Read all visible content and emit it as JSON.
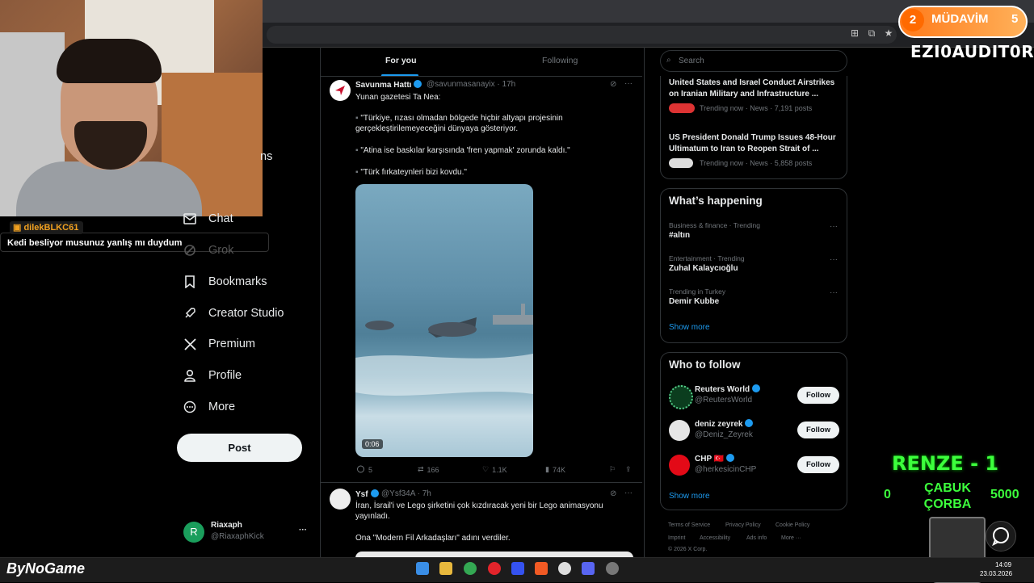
{
  "tabs": {
    "for_you": "For you",
    "following": "Following"
  },
  "nav": {
    "partial": "ns",
    "chat": "Chat",
    "grok": "Grok",
    "bookmarks": "Bookmarks",
    "creator_studio": "Creator Studio",
    "premium": "Premium",
    "profile": "Profile",
    "more": "More",
    "post": "Post"
  },
  "account": {
    "initial": "R",
    "name": "Riaxaph",
    "handle": "@RiaxaphKick",
    "menu": "···"
  },
  "chat_overlay": {
    "user": "dilekBLKC61",
    "message": "Kedi besliyor musunuz yanlış mı duydum"
  },
  "tweets": [
    {
      "name": "Savunma Hattı",
      "handle": "@savunmasanayix · 17h",
      "lines": [
        "Yunan gazetesi Ta Nea:",
        "\"Türkiye, rızası olmadan bölgede hiçbir altyapı projesinin gerçekleştirilemeyeceğini dünyaya gösteriyor.",
        "\"Atina ise baskılar karşısında 'fren yapmak' zorunda kaldı.\"",
        "\"Türk fırkateynleri bizi kovdu.\""
      ],
      "video_time": "0:06",
      "replies": "5",
      "reposts": "166",
      "likes": "1.1K",
      "views": "74K"
    },
    {
      "name": "Ysf",
      "handle": "@Ysf34A · 7h",
      "lines": [
        "İran, İsrail'i ve Lego şirketini çok kızdıracak yeni bir Lego animasyonu yayınladı.",
        "Ona \"Modern Fil Arkadaşları\" adını verdiler."
      ]
    }
  ],
  "search": {
    "placeholder": "Search"
  },
  "news": [
    {
      "title": "United States and Israel Conduct Airstrikes on Iranian Military and Infrastructure ...",
      "meta": "Trending now · News · 7,191 posts"
    },
    {
      "title": "US President Donald Trump Issues 48-Hour Ultimatum to Iran to Reopen Strait of ...",
      "meta": "Trending now · News · 5,858 posts"
    }
  ],
  "whats_happening": {
    "title": "What’s happening",
    "trends": [
      {
        "category": "Business & finance · Trending",
        "name": "#altın"
      },
      {
        "category": "Entertainment · Trending",
        "name": "Zuhal Kalaycıoğlu"
      },
      {
        "category": "Trending in Turkey",
        "name": "Demir Kubbe"
      }
    ],
    "show_more": "Show more",
    "more_icon": "···"
  },
  "who_to_follow": {
    "title": "Who to follow",
    "accounts": [
      {
        "name": "Reuters World",
        "handle": "@ReutersWorld",
        "button": "Follow"
      },
      {
        "name": "deniz zeyrek",
        "handle": "@Deniz_Zeyrek",
        "button": "Follow"
      },
      {
        "name": "CHP 🇹🇷",
        "handle": "@herkesicinCHP",
        "button": "Follow"
      }
    ],
    "show_more": "Show more"
  },
  "footer": {
    "links": [
      "Terms of Service",
      "Privacy Policy",
      "Cookie Policy",
      "Imprint",
      "Accessibility",
      "Ads info",
      "More ···"
    ],
    "copyright": "© 2026 X Corp."
  },
  "overlays": {
    "badge_left": "2",
    "badge_label": "MÜDAVİM",
    "badge_right": "5",
    "streamer": "EZI0AUDIT0R",
    "game": "RENZE - 1",
    "score_left": "0",
    "score_label": "ÇABUK ÇORBA",
    "score_right": "5000",
    "logo": "ByNoGame"
  },
  "taskbar": {
    "time": "14:09",
    "date": "23.03.2026"
  },
  "colors": {
    "accent": "#1d9bf0",
    "overlay_green": "#3cff3c",
    "badge_orange": "#ff7a1a"
  }
}
